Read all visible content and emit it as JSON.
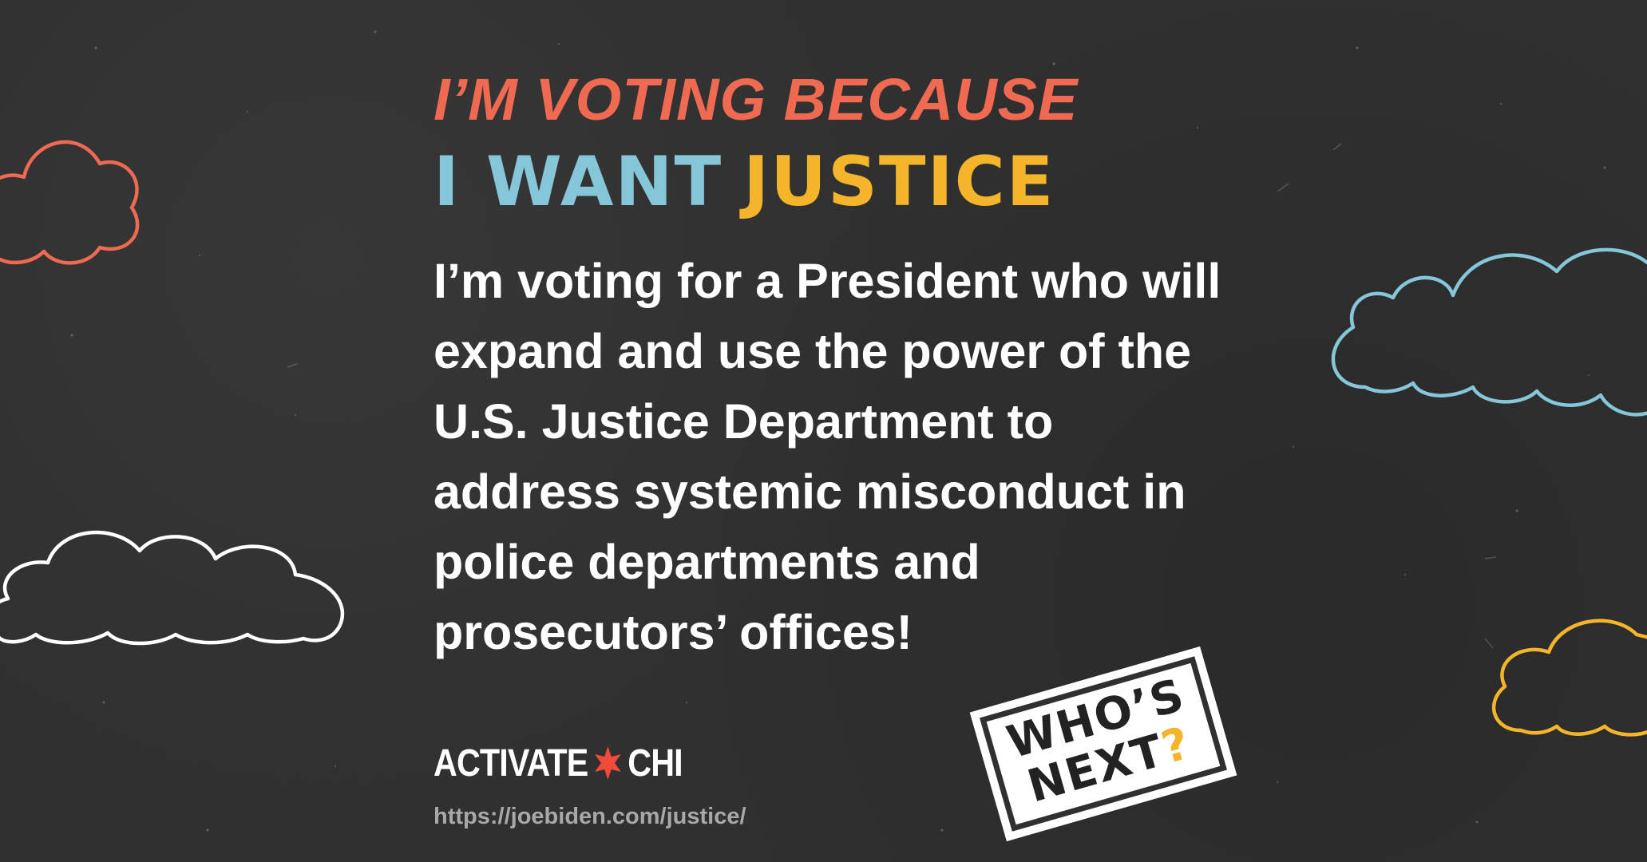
{
  "headline": "I’M VOTING BECAUSE",
  "subheadline": {
    "part_a": "I WANT",
    "part_b": "JUSTICE"
  },
  "body_text": "I’m voting for a President who will\nexpand and use the power of the\nU.S. Justice Department to\naddress systemic misconduct in\npolice departments and\nprosecutors’ offices!",
  "logo": {
    "left": "ACTIVATE",
    "right": "CHI",
    "icon": "six-point-star-icon"
  },
  "url": "https://joebiden.com/justice/",
  "stamp": {
    "line1": "WHO’S",
    "line2": "NEXT",
    "mark": "?"
  },
  "colors": {
    "background": "#303030",
    "headline": "#ef6a50",
    "subheadline_a": "#86c6d9",
    "subheadline_b": "#f5b52a",
    "body": "#ffffff",
    "url": "#a8a8a8",
    "cloud_orange": "#ef6a50",
    "cloud_blue": "#86c6d9",
    "cloud_white": "#ffffff",
    "cloud_yellow": "#f5b52a",
    "star": "#ef4a3a"
  }
}
